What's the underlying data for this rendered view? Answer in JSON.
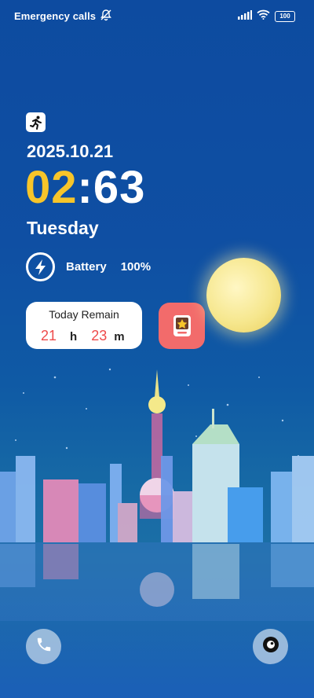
{
  "status_bar": {
    "carrier_text": "Emergency calls",
    "battery_level": "100"
  },
  "clock": {
    "date": "2025.10.21",
    "hours": "02",
    "separator": ":",
    "minutes": "63",
    "weekday": "Tuesday"
  },
  "battery_widget": {
    "label": "Battery",
    "value": "100%"
  },
  "remain_widget": {
    "title": "Today Remain",
    "hours_value": "21",
    "hours_unit": "h",
    "minutes_value": "23",
    "minutes_unit": "m"
  },
  "icons": {
    "status_mute": "bell-off-icon",
    "signal": "signal-bars-icon",
    "wifi": "wifi-icon",
    "battery": "battery-icon",
    "activity": "running-person-icon",
    "charge": "lightning-bolt-icon",
    "app": "star-badge-app-icon",
    "phone": "phone-icon",
    "camera": "camera-icon"
  },
  "colors": {
    "hour_accent": "#f7c52a",
    "remain_number": "#ee4a4a",
    "app_tile": "#f26b6b"
  }
}
